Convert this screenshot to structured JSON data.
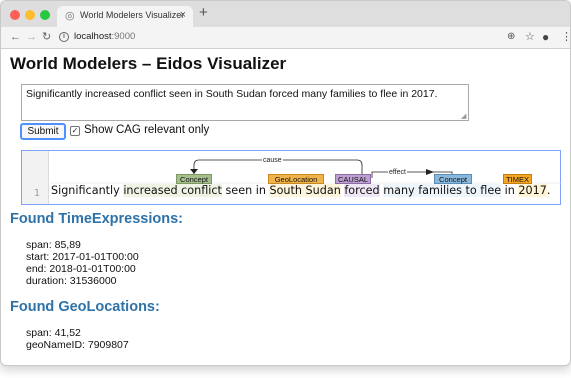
{
  "browser": {
    "tab_title": "World Modelers Visualizer",
    "url_host": "localhost",
    "url_port": ":9000",
    "icons": {
      "back": "back-arrow-icon",
      "forward": "forward-arrow-icon",
      "reload": "reload-icon",
      "info": "info-icon",
      "zoom": "zoom-icon",
      "bookmark": "star-icon",
      "account": "account-icon",
      "menu": "kebab-menu-icon"
    }
  },
  "page": {
    "title": "World Modelers – Eidos Visualizer",
    "input_text": "Significantly increased conflict seen in South Sudan forced many families to flee in 2017.",
    "submit_label": "Submit",
    "checkbox_label": "Show CAG relevant only",
    "checkbox_checked": true
  },
  "visualization": {
    "line_number": "1",
    "tokens": [
      {
        "text": "Significantly ",
        "cls": ""
      },
      {
        "text": "increased conflict",
        "cls": "hl-concept"
      },
      {
        "text": " seen in ",
        "cls": ""
      },
      {
        "text": "South Sudan",
        "cls": "hl-geo"
      },
      {
        "text": " ",
        "cls": ""
      },
      {
        "text": "forced",
        "cls": "hl-causal"
      },
      {
        "text": " ",
        "cls": ""
      },
      {
        "text": "many families to flee",
        "cls": "hl-concept2"
      },
      {
        "text": " in ",
        "cls": ""
      },
      {
        "text": "2017",
        "cls": "hl-time"
      },
      {
        "text": ".",
        "cls": ""
      }
    ],
    "labels": {
      "concept": "Concept",
      "geolocation": "GeoLocation",
      "causal": "CAUSAL",
      "concept2": "Concept",
      "timex": "TIMEX"
    },
    "arcs": {
      "cause": "cause",
      "effect": "effect"
    },
    "colors": {
      "concept": "#a4be8c",
      "geolocation": "#f0b44a",
      "causal": "#bd9fd0",
      "concept2": "#8ab7dc",
      "timex": "#f5a623",
      "panel_border": "#7fa2ff"
    }
  },
  "time_expressions": {
    "heading": "Found TimeExpressions:",
    "span": "span: 85,89",
    "start": "start: 2017-01-01T00:00",
    "end": "end: 2018-01-01T00:00",
    "duration": "duration: 31536000"
  },
  "geo_locations": {
    "heading": "Found GeoLocations:",
    "span": "span: 41,52",
    "geonameid": "geoNameID: 7909807"
  },
  "theme": {
    "heading_color": "#2e72a8"
  }
}
